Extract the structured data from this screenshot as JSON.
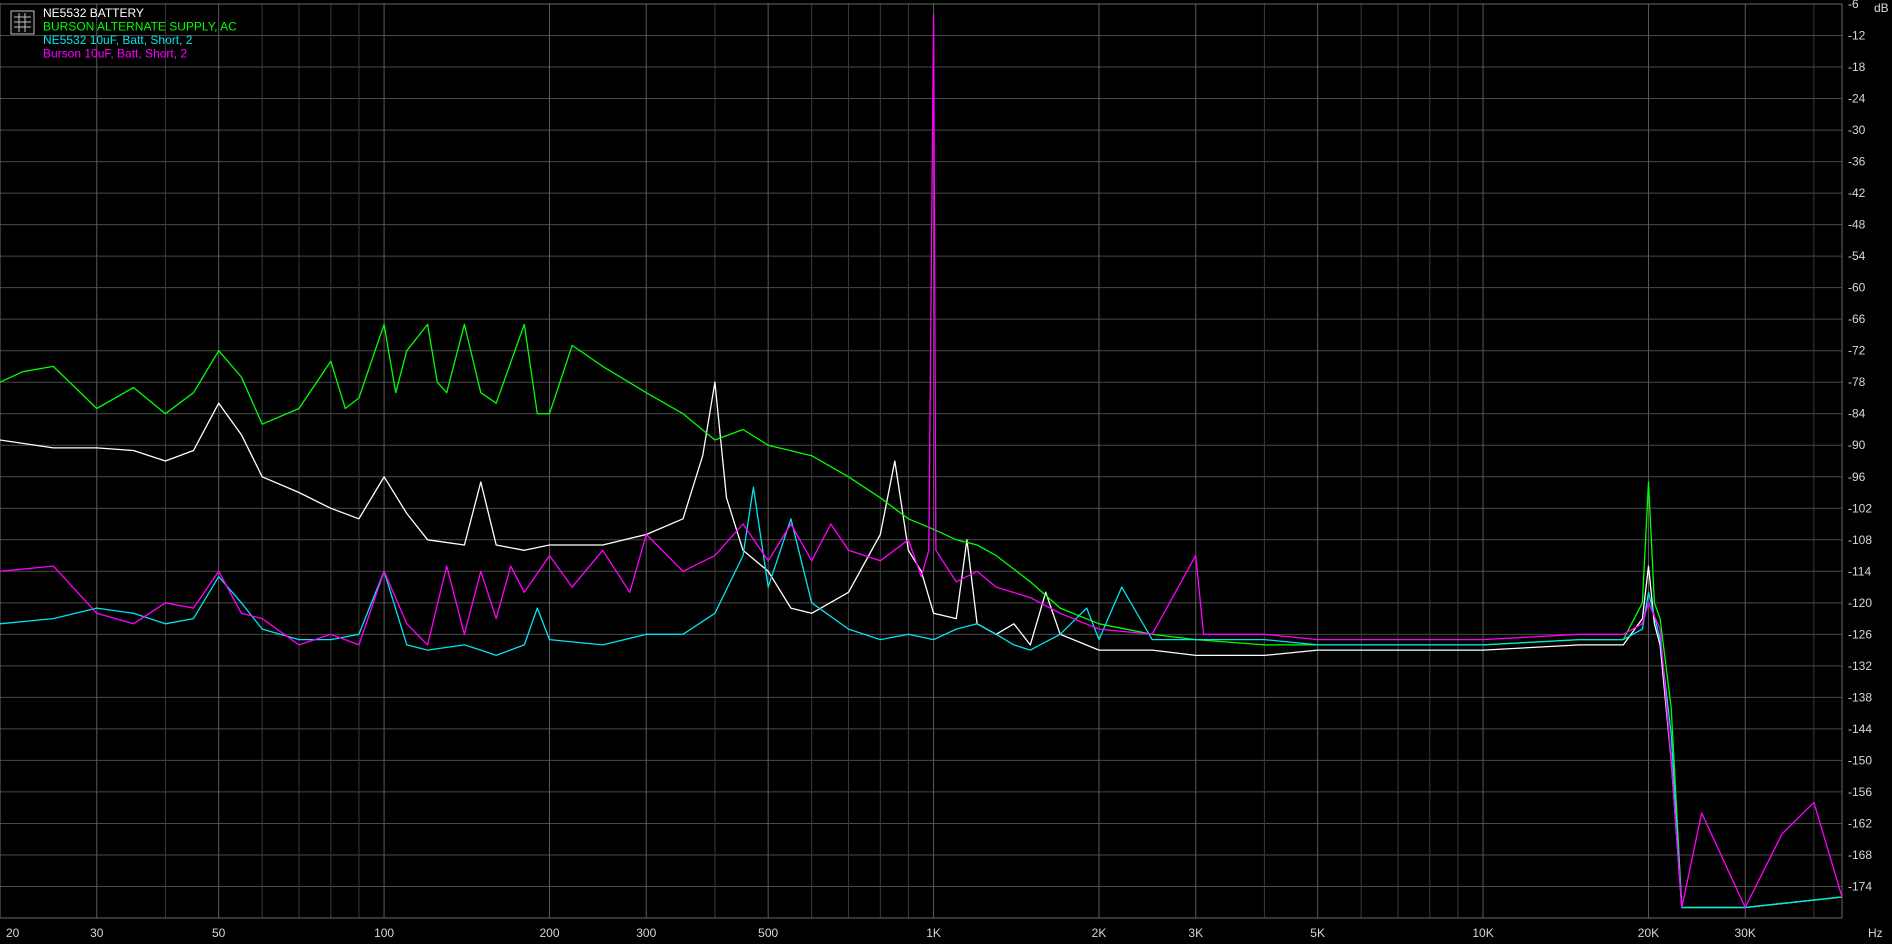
{
  "chart_data": {
    "type": "line",
    "x_scale": "log",
    "xlim": [
      20,
      45000
    ],
    "ylim": [
      -180,
      -6
    ],
    "y_unit": "dB",
    "x_unit": "Hz",
    "x_ticks": [
      {
        "v": 20,
        "label": "20"
      },
      {
        "v": 30,
        "label": "30"
      },
      {
        "v": 50,
        "label": "50"
      },
      {
        "v": 100,
        "label": "100"
      },
      {
        "v": 200,
        "label": "200"
      },
      {
        "v": 300,
        "label": "300"
      },
      {
        "v": 500,
        "label": "500"
      },
      {
        "v": 1000,
        "label": "1K"
      },
      {
        "v": 2000,
        "label": "2K"
      },
      {
        "v": 3000,
        "label": "3K"
      },
      {
        "v": 5000,
        "label": "5K"
      },
      {
        "v": 10000,
        "label": "10K"
      },
      {
        "v": 20000,
        "label": "20K"
      },
      {
        "v": 30000,
        "label": "30K"
      }
    ],
    "minor_x": [
      40,
      60,
      70,
      80,
      90,
      400,
      600,
      700,
      800,
      900,
      4000,
      6000,
      7000,
      8000,
      9000,
      40000
    ],
    "y_ticks": [
      -6,
      -12,
      -18,
      -24,
      -30,
      -36,
      -42,
      -48,
      -54,
      -60,
      -66,
      -72,
      -78,
      -84,
      -90,
      -96,
      -102,
      -108,
      -114,
      -120,
      -126,
      -132,
      -138,
      -144,
      -150,
      -156,
      -162,
      -168,
      -174
    ],
    "grid": true,
    "legend_position": "top-left",
    "series": [
      {
        "name": "NE5532 BATTERY",
        "color": "#ffffff",
        "points": [
          [
            20,
            -89
          ],
          [
            25,
            -90.5
          ],
          [
            30,
            -90.5
          ],
          [
            35,
            -91
          ],
          [
            40,
            -93
          ],
          [
            45,
            -91
          ],
          [
            50,
            -82
          ],
          [
            55,
            -88
          ],
          [
            60,
            -96
          ],
          [
            70,
            -99
          ],
          [
            80,
            -102
          ],
          [
            90,
            -104
          ],
          [
            100,
            -96
          ],
          [
            110,
            -103
          ],
          [
            120,
            -108
          ],
          [
            140,
            -109
          ],
          [
            150,
            -97
          ],
          [
            160,
            -109
          ],
          [
            180,
            -110
          ],
          [
            200,
            -109
          ],
          [
            250,
            -109
          ],
          [
            300,
            -107
          ],
          [
            350,
            -104
          ],
          [
            380,
            -92
          ],
          [
            400,
            -78
          ],
          [
            420,
            -100
          ],
          [
            450,
            -110
          ],
          [
            500,
            -114
          ],
          [
            550,
            -121
          ],
          [
            600,
            -122
          ],
          [
            700,
            -118
          ],
          [
            800,
            -107
          ],
          [
            850,
            -93
          ],
          [
            900,
            -110
          ],
          [
            950,
            -114
          ],
          [
            1000,
            -122
          ],
          [
            1100,
            -123
          ],
          [
            1150,
            -108
          ],
          [
            1200,
            -124
          ],
          [
            1300,
            -126
          ],
          [
            1400,
            -124
          ],
          [
            1500,
            -128
          ],
          [
            1600,
            -118
          ],
          [
            1700,
            -126
          ],
          [
            2000,
            -129
          ],
          [
            2500,
            -129
          ],
          [
            3000,
            -130
          ],
          [
            4000,
            -130
          ],
          [
            5000,
            -129
          ],
          [
            7000,
            -129
          ],
          [
            10000,
            -129
          ],
          [
            15000,
            -128
          ],
          [
            18000,
            -128
          ],
          [
            19500,
            -123
          ],
          [
            20000,
            -113
          ],
          [
            20500,
            -124
          ],
          [
            21000,
            -128
          ],
          [
            22000,
            -150
          ],
          [
            23000,
            -178
          ],
          [
            30000,
            -178
          ],
          [
            45000,
            -176
          ]
        ]
      },
      {
        "name": "BURSON ALTERNATE SUPPLY, AC",
        "color": "#00ff00",
        "points": [
          [
            20,
            -78
          ],
          [
            22,
            -76
          ],
          [
            25,
            -75
          ],
          [
            30,
            -83
          ],
          [
            35,
            -79
          ],
          [
            40,
            -84
          ],
          [
            45,
            -80
          ],
          [
            50,
            -72
          ],
          [
            55,
            -77
          ],
          [
            60,
            -86
          ],
          [
            70,
            -83
          ],
          [
            80,
            -74
          ],
          [
            85,
            -83
          ],
          [
            90,
            -81
          ],
          [
            100,
            -67
          ],
          [
            105,
            -80
          ],
          [
            110,
            -72
          ],
          [
            120,
            -67
          ],
          [
            125,
            -78
          ],
          [
            130,
            -80
          ],
          [
            140,
            -67
          ],
          [
            150,
            -80
          ],
          [
            160,
            -82
          ],
          [
            180,
            -67
          ],
          [
            190,
            -84
          ],
          [
            200,
            -84
          ],
          [
            220,
            -71
          ],
          [
            250,
            -75
          ],
          [
            300,
            -80
          ],
          [
            350,
            -84
          ],
          [
            400,
            -89
          ],
          [
            450,
            -87
          ],
          [
            500,
            -90
          ],
          [
            600,
            -92
          ],
          [
            700,
            -96
          ],
          [
            800,
            -100
          ],
          [
            900,
            -104
          ],
          [
            1000,
            -106
          ],
          [
            1100,
            -108
          ],
          [
            1200,
            -109
          ],
          [
            1300,
            -111
          ],
          [
            1500,
            -116
          ],
          [
            1700,
            -121
          ],
          [
            2000,
            -124
          ],
          [
            2500,
            -126
          ],
          [
            3000,
            -127
          ],
          [
            4000,
            -128
          ],
          [
            5000,
            -128
          ],
          [
            7000,
            -128
          ],
          [
            10000,
            -128
          ],
          [
            15000,
            -127
          ],
          [
            18000,
            -127
          ],
          [
            19500,
            -120
          ],
          [
            20000,
            -97
          ],
          [
            20500,
            -120
          ],
          [
            21000,
            -123
          ],
          [
            22000,
            -140
          ],
          [
            23000,
            -178
          ],
          [
            30000,
            -178
          ],
          [
            45000,
            -176
          ]
        ]
      },
      {
        "name": "NE5532 10uF, Batt, Short, 2",
        "color": "#00e5ee",
        "points": [
          [
            20,
            -124
          ],
          [
            25,
            -123
          ],
          [
            30,
            -121
          ],
          [
            35,
            -122
          ],
          [
            40,
            -124
          ],
          [
            45,
            -123
          ],
          [
            50,
            -115
          ],
          [
            55,
            -120
          ],
          [
            60,
            -125
          ],
          [
            70,
            -127
          ],
          [
            80,
            -127
          ],
          [
            90,
            -126
          ],
          [
            100,
            -114
          ],
          [
            110,
            -128
          ],
          [
            120,
            -129
          ],
          [
            140,
            -128
          ],
          [
            150,
            -129
          ],
          [
            160,
            -130
          ],
          [
            180,
            -128
          ],
          [
            190,
            -121
          ],
          [
            200,
            -127
          ],
          [
            250,
            -128
          ],
          [
            300,
            -126
          ],
          [
            350,
            -126
          ],
          [
            400,
            -122
          ],
          [
            450,
            -111
          ],
          [
            470,
            -98
          ],
          [
            500,
            -117
          ],
          [
            550,
            -104
          ],
          [
            600,
            -120
          ],
          [
            700,
            -125
          ],
          [
            800,
            -127
          ],
          [
            900,
            -126
          ],
          [
            1000,
            -127
          ],
          [
            1100,
            -125
          ],
          [
            1200,
            -124
          ],
          [
            1300,
            -126
          ],
          [
            1400,
            -128
          ],
          [
            1500,
            -129
          ],
          [
            1700,
            -126
          ],
          [
            1900,
            -121
          ],
          [
            2000,
            -127
          ],
          [
            2200,
            -117
          ],
          [
            2500,
            -127
          ],
          [
            3000,
            -127
          ],
          [
            4000,
            -127
          ],
          [
            5000,
            -128
          ],
          [
            7000,
            -128
          ],
          [
            10000,
            -128
          ],
          [
            15000,
            -127
          ],
          [
            18000,
            -127
          ],
          [
            19500,
            -125
          ],
          [
            20000,
            -118
          ],
          [
            21000,
            -127
          ],
          [
            22000,
            -145
          ],
          [
            23000,
            -178
          ],
          [
            30000,
            -178
          ],
          [
            45000,
            -176
          ]
        ]
      },
      {
        "name": "Burson 10uF, Batt, Short, 2",
        "color": "#ff00ff",
        "points": [
          [
            20,
            -114
          ],
          [
            25,
            -113
          ],
          [
            30,
            -122
          ],
          [
            35,
            -124
          ],
          [
            40,
            -120
          ],
          [
            45,
            -121
          ],
          [
            50,
            -114
          ],
          [
            55,
            -122
          ],
          [
            60,
            -123
          ],
          [
            70,
            -128
          ],
          [
            80,
            -126
          ],
          [
            90,
            -128
          ],
          [
            100,
            -114
          ],
          [
            110,
            -124
          ],
          [
            120,
            -128
          ],
          [
            130,
            -113
          ],
          [
            140,
            -126
          ],
          [
            150,
            -114
          ],
          [
            160,
            -123
          ],
          [
            170,
            -113
          ],
          [
            180,
            -118
          ],
          [
            200,
            -111
          ],
          [
            220,
            -117
          ],
          [
            250,
            -110
          ],
          [
            280,
            -118
          ],
          [
            300,
            -107
          ],
          [
            350,
            -114
          ],
          [
            400,
            -111
          ],
          [
            450,
            -105
          ],
          [
            500,
            -112
          ],
          [
            550,
            -105
          ],
          [
            600,
            -112
          ],
          [
            650,
            -105
          ],
          [
            700,
            -110
          ],
          [
            800,
            -112
          ],
          [
            900,
            -108
          ],
          [
            950,
            -115
          ],
          [
            980,
            -110
          ],
          [
            1000,
            -8
          ],
          [
            1010,
            -110
          ],
          [
            1100,
            -116
          ],
          [
            1200,
            -114
          ],
          [
            1300,
            -117
          ],
          [
            1500,
            -119
          ],
          [
            1700,
            -122
          ],
          [
            2000,
            -125
          ],
          [
            2500,
            -126
          ],
          [
            3000,
            -111
          ],
          [
            3100,
            -126
          ],
          [
            4000,
            -126
          ],
          [
            5000,
            -127
          ],
          [
            7000,
            -127
          ],
          [
            10000,
            -127
          ],
          [
            15000,
            -126
          ],
          [
            18000,
            -126
          ],
          [
            19500,
            -124
          ],
          [
            20000,
            -120
          ],
          [
            21000,
            -125
          ],
          [
            22000,
            -150
          ],
          [
            23000,
            -178
          ],
          [
            25000,
            -160
          ],
          [
            30000,
            -178
          ],
          [
            35000,
            -164
          ],
          [
            40000,
            -158
          ],
          [
            45000,
            -176
          ]
        ]
      }
    ]
  }
}
